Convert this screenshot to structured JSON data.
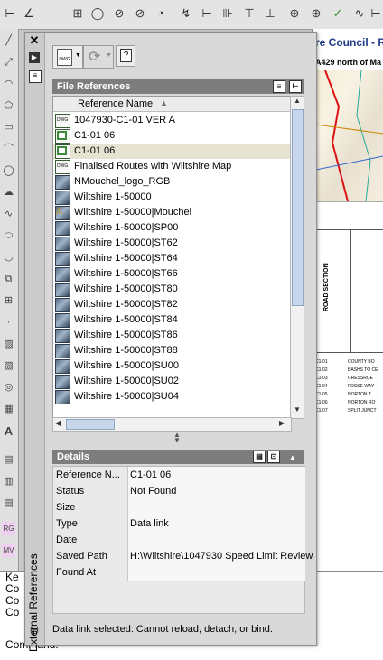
{
  "palette": {
    "title": "External References",
    "file_references": {
      "header": "File References",
      "column_header": "Reference Name",
      "rows": [
        {
          "name": "1047930-C1-01 VER A",
          "icon": "dwg-xref-icon"
        },
        {
          "name": "C1-01 06",
          "icon": "data-link-icon"
        },
        {
          "name": "C1-01 06",
          "icon": "data-link-icon",
          "selected": true
        },
        {
          "name": "Finalised Routes with Wiltshire Map",
          "icon": "dwg-xref-icon"
        },
        {
          "name": "NMouchel_logo_RGB",
          "icon": "raster-image-icon"
        },
        {
          "name": "Wiltshire 1-50000",
          "icon": "raster-image-icon"
        },
        {
          "name": "Wiltshire 1-50000|Mouchel",
          "icon": "warning-icon"
        },
        {
          "name": "Wiltshire 1-50000|SP00",
          "icon": "raster-image-icon"
        },
        {
          "name": "Wiltshire 1-50000|ST62",
          "icon": "raster-image-icon"
        },
        {
          "name": "Wiltshire 1-50000|ST64",
          "icon": "raster-image-icon"
        },
        {
          "name": "Wiltshire 1-50000|ST66",
          "icon": "raster-image-icon"
        },
        {
          "name": "Wiltshire 1-50000|ST80",
          "icon": "raster-image-icon"
        },
        {
          "name": "Wiltshire 1-50000|ST82",
          "icon": "raster-image-icon"
        },
        {
          "name": "Wiltshire 1-50000|ST84",
          "icon": "raster-image-icon"
        },
        {
          "name": "Wiltshire 1-50000|ST86",
          "icon": "raster-image-icon"
        },
        {
          "name": "Wiltshire 1-50000|ST88",
          "icon": "raster-image-icon"
        },
        {
          "name": "Wiltshire 1-50000|SU00",
          "icon": "raster-image-icon"
        },
        {
          "name": "Wiltshire 1-50000|SU02",
          "icon": "raster-image-icon"
        },
        {
          "name": "Wiltshire 1-50000|SU04",
          "icon": "raster-image-icon"
        }
      ]
    },
    "details": {
      "header": "Details",
      "rows": [
        {
          "key": "Reference N...",
          "value": "C1-01 06"
        },
        {
          "key": "Status",
          "value": "Not Found"
        },
        {
          "key": "Size",
          "value": ""
        },
        {
          "key": "Type",
          "value": "Data link"
        },
        {
          "key": "Date",
          "value": ""
        },
        {
          "key": "Saved Path",
          "value": "H:\\Wiltshire\\1047930 Speed Limit Review"
        },
        {
          "key": "Found At",
          "value": ""
        }
      ]
    },
    "status_message": "Data link selected: Cannot reload, detach, or bind."
  },
  "background": {
    "drawing_title": "re Council - Re",
    "drawing_subtitle": "A429 north of Ma",
    "road_section_label": "ROAD SECTION",
    "table_codes": [
      "C1-01",
      "C1-02",
      "C1-03",
      "C1-04",
      "C1-05",
      "C1-06",
      "C1-07"
    ],
    "table_names": [
      "COUNTY BO",
      "BASHS TO CE",
      "CRESSRCE",
      "FOSSE WAY",
      "NORTON T",
      "NORTON RO",
      "SPLIT JUNCT"
    ],
    "command_lines": [
      "Ke",
      "Co",
      "Co",
      "Co",
      "Command:"
    ]
  },
  "colors": {
    "panel_header_bg": "#7d7d7d",
    "selected_row_bg": "#e7e3d2"
  }
}
